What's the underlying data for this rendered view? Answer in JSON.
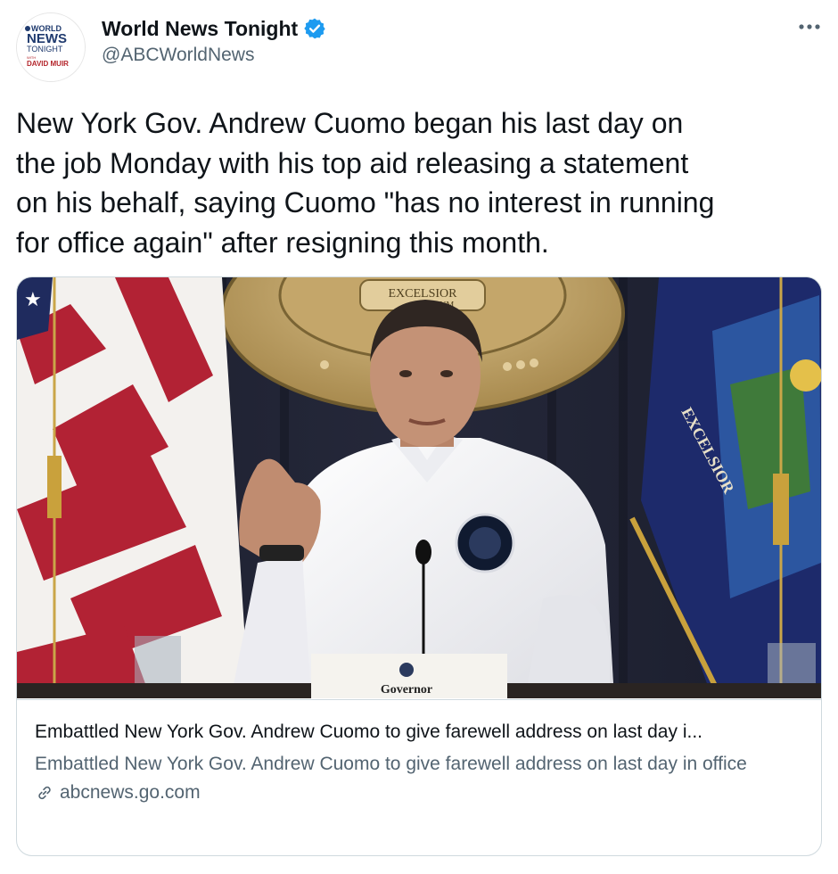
{
  "author": {
    "name": "World News Tonight",
    "handle": "@ABCWorldNews",
    "verified": true,
    "avatar_text": {
      "line1": "WORLD",
      "line2": "NEWS",
      "line3": "TONIGHT",
      "line4": "WITH",
      "line5": "DAVID MUIR"
    }
  },
  "more_icon": "more-horizontal-icon",
  "tweet": {
    "text": "New York Gov. Andrew Cuomo began his last day on\nthe job Monday with his top aid releasing a statement\non his behalf, saying Cuomo \"has no interest in running\nfor office again\" after resigning this month."
  },
  "card": {
    "image_text": {
      "seal_top": "EXCELSIOR",
      "seal_unum": "UNUM",
      "flag_motto": "EXCELSIOR",
      "placard": "Governor"
    },
    "title": "Embattled New York Gov. Andrew Cuomo to give farewell address on last day i...",
    "description": "Embattled New York Gov. Andrew Cuomo to give farewell address on last day in office",
    "domain": "abcnews.go.com",
    "link_icon": "link-icon"
  },
  "colors": {
    "text_primary": "#0f1419",
    "text_secondary": "#536471",
    "border": "#cfd9de",
    "verified_blue": "#1d9bf0"
  }
}
